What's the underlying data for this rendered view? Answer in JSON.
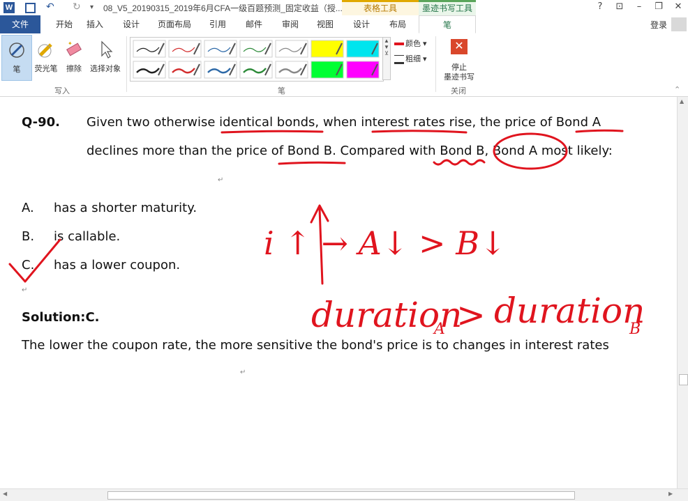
{
  "titlebar": {
    "doc_title": "08_V5_20190315_2019年6月CFA一级百题预测_固定收益（授...",
    "ctx_table": "表格工具",
    "ctx_ink": "墨迹书写工具",
    "help": "?",
    "restore_ribbon": "⊡",
    "minimize": "–",
    "maximize": "❐",
    "close": "✕"
  },
  "menu": {
    "tabs": [
      "文件",
      "开始",
      "插入",
      "设计",
      "页面布局",
      "引用",
      "邮件",
      "审阅",
      "视图",
      "设计",
      "布局",
      "笔"
    ],
    "login": "登录"
  },
  "ribbon": {
    "write_tools": [
      "笔",
      "荧光笔",
      "擦除",
      "选择对象"
    ],
    "group_write": "写入",
    "group_pen": "笔",
    "color_label": "颜色",
    "thickness_label": "粗细",
    "stop_label_1": "停止",
    "stop_label_2": "墨迹书写",
    "group_close": "关闭"
  },
  "pen_colors": {
    "row1": [
      "#222222",
      "#d32f2f",
      "#2e6aa8",
      "#2e8b3a",
      "#888888",
      "#ffff00",
      "#00e5ee"
    ],
    "row2": [
      "#222222",
      "#d32f2f",
      "#2e6aa8",
      "#2e8b3a",
      "#888888",
      "#00ff33",
      "#ff00ff"
    ]
  },
  "question": {
    "number": "Q-90.",
    "line1": "Given two otherwise identical bonds, when interest rates rise, the price of Bond A",
    "line2": "declines more than the price of Bond B. Compared with Bond B, Bond A most likely:"
  },
  "options": [
    {
      "letter": "A.",
      "text": "has a shorter maturity."
    },
    {
      "letter": "B.",
      "text": "is callable."
    },
    {
      "letter": "C.",
      "text": "has a lower coupon."
    }
  ],
  "solution": {
    "label": "Solution:C.",
    "text": "The lower the coupon rate, the more sensitive the bond's price is to changes in interest rates"
  },
  "handwriting": {
    "line1": "i ↑ → A↓ > B↓",
    "line2_a": "duration",
    "sub_a": "A",
    "gt": ">",
    "line2_b": "duration",
    "sub_b": "B"
  },
  "ink_color": "#e0141e"
}
